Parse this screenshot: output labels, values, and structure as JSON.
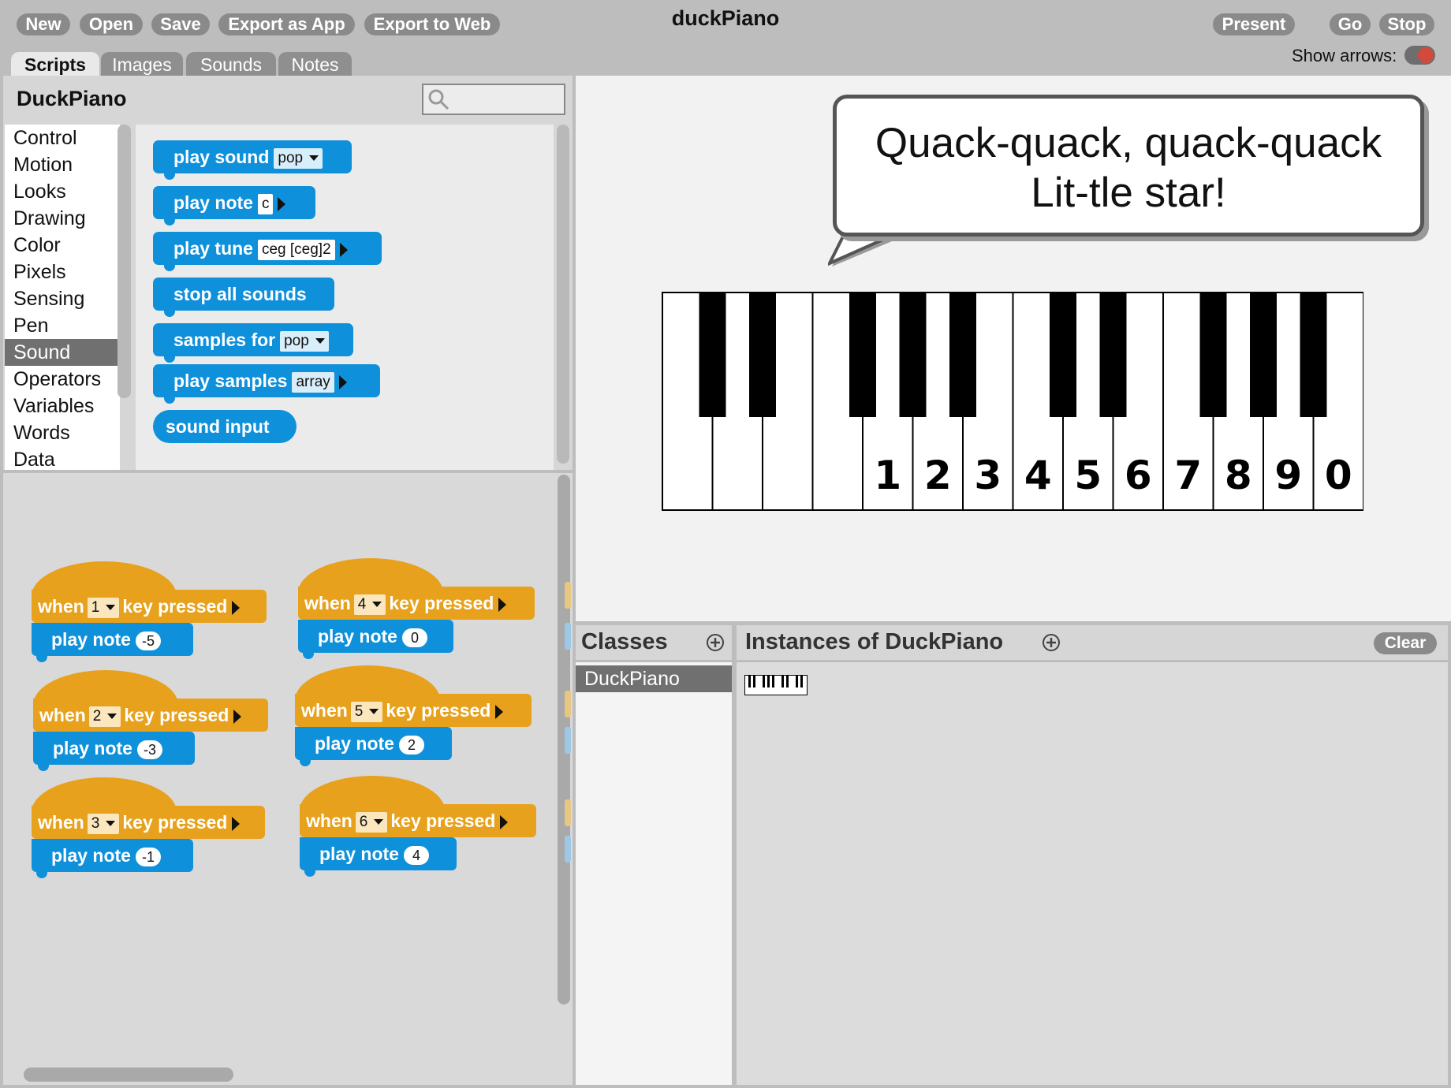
{
  "toolbar": {
    "new": "New",
    "open": "Open",
    "save": "Save",
    "export_app": "Export as App",
    "export_web": "Export to Web",
    "present": "Present",
    "go": "Go",
    "stop": "Stop"
  },
  "project_title": "duckPiano",
  "show_arrows_label": "Show arrows:",
  "tabs": [
    "Scripts",
    "Images",
    "Sounds",
    "Notes"
  ],
  "class_name": "DuckPiano",
  "categories": [
    "Control",
    "Motion",
    "Looks",
    "Drawing",
    "Color",
    "Pixels",
    "Sensing",
    "Pen",
    "Sound",
    "Operators",
    "Variables",
    "Words",
    "Data"
  ],
  "selected_category": "Sound",
  "palette_blocks": {
    "play_sound": {
      "label": "play sound",
      "arg": "pop"
    },
    "play_note": {
      "label": "play note",
      "arg": "c"
    },
    "play_tune": {
      "label": "play tune",
      "arg": "ceg [ceg]2"
    },
    "stop_all_sounds": {
      "label": "stop all sounds"
    },
    "samples_for": {
      "label": "samples for",
      "arg": "pop"
    },
    "play_samples": {
      "label": "play samples",
      "arg": "array"
    },
    "sound_input": {
      "label": "sound input"
    }
  },
  "scripts": [
    {
      "when": "when",
      "key": "1",
      "pressed": "key pressed",
      "cmd": "play note",
      "value": "-5"
    },
    {
      "when": "when",
      "key": "4",
      "pressed": "key pressed",
      "cmd": "play note",
      "value": "0"
    },
    {
      "when": "when",
      "key": "2",
      "pressed": "key pressed",
      "cmd": "play note",
      "value": "-3"
    },
    {
      "when": "when",
      "key": "5",
      "pressed": "key pressed",
      "cmd": "play note",
      "value": "2"
    },
    {
      "when": "when",
      "key": "3",
      "pressed": "key pressed",
      "cmd": "play note",
      "value": "-1"
    },
    {
      "when": "when",
      "key": "6",
      "pressed": "key pressed",
      "cmd": "play note",
      "value": "4"
    }
  ],
  "stage": {
    "speech_line1": "Quack-quack, quack-quack",
    "speech_line2": "Lit-tle star!",
    "piano_key_labels": [
      "1",
      "2",
      "3",
      "4",
      "5",
      "6",
      "7",
      "8",
      "9",
      "0"
    ]
  },
  "classes_pane": {
    "title": "Classes",
    "items": [
      "DuckPiano"
    ]
  },
  "instances_pane": {
    "title": "Instances of DuckPiano",
    "clear": "Clear"
  },
  "colors": {
    "sound_block": "#0f90db",
    "event_block": "#e7a11c",
    "toolbar_button": "#8a8a8a",
    "selection": "#707070"
  }
}
